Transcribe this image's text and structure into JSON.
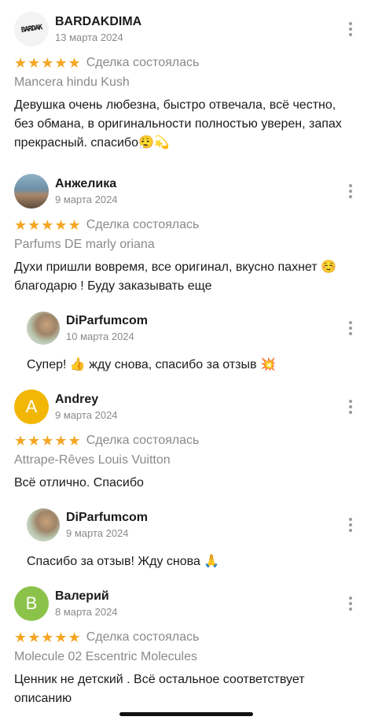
{
  "reviews": [
    {
      "author": "BARDAKDIMA",
      "avatar_text": "BARDAK",
      "date": "13 марта 2024",
      "stars": "★★★★★",
      "status": "Сделка состоялась",
      "product": "Mancera hindu Kush",
      "text": "Девушка очень любезна, быстро отвечала, всё честно, без обмана, в оригинальности полностью уверен, запах прекрасный. спасибо😮‍💨💫"
    },
    {
      "author": "Анжелика",
      "date": "9 марта 2024",
      "stars": "★★★★★",
      "status": "Сделка состоялась",
      "product": "Parfums DE marly oriana",
      "text": "Духи пришли вовремя, все оригинал, вкусно пахнет ☺️ благодарю ! Буду заказывать еще",
      "reply": {
        "author": "DiParfumcom",
        "date": "10 марта 2024",
        "text": "Супер! 👍 жду снова, спасибо за отзыв 💥"
      }
    },
    {
      "author": "Andrey",
      "avatar_letter": "A",
      "avatar_color": "#f2b705",
      "date": "9 марта 2024",
      "stars": "★★★★★",
      "status": "Сделка состоялась",
      "product": "Attrape-Rêves Louis Vuitton",
      "text": "Всё отлично. Спасибо",
      "reply": {
        "author": "DiParfumcom",
        "date": "9 марта 2024",
        "text": "Спасибо  за отзыв! Жду снова 🙏"
      }
    },
    {
      "author": "Валерий",
      "avatar_letter": "В",
      "avatar_color": "#8bc34a",
      "date": "8 марта 2024",
      "stars": "★★★★★",
      "status": "Сделка состоялась",
      "product": "Molecule 02 Escentric Molecules",
      "text": "Ценник не детский . Всё остальное соответствует описанию"
    }
  ],
  "colors": {
    "star": "#f5a623",
    "muted": "#8a8a8a"
  }
}
